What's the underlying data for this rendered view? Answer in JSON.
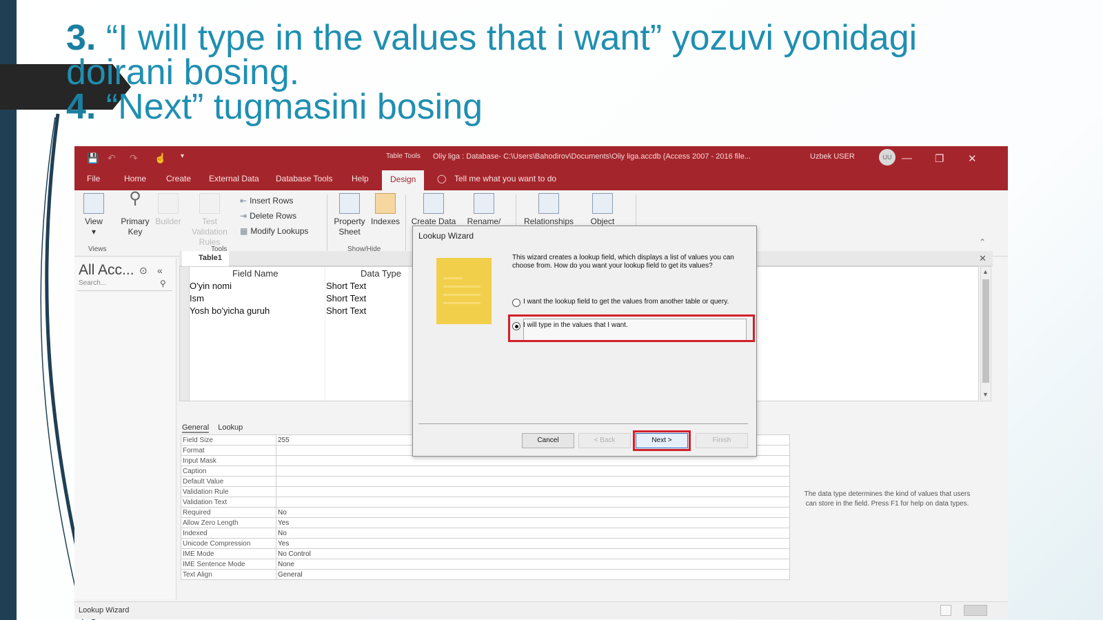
{
  "slide": {
    "line1_num": "3.",
    "line1_text": " “I will type in the values that i want” yozuvi yonidagi",
    "line2_text": "doirani bosing.",
    "line3_num": "4.",
    "line3_text": "  “Next” tugmasini bosing"
  },
  "window": {
    "context_tab": "Table Tools",
    "title": "Oliy liga : Database- C:\\Users\\Bahodirov\\Documents\\Oliy liga.accdb (Access 2007 - 2016 file...",
    "user": "Uzbek USER",
    "avatar_initials": "UU"
  },
  "menu": [
    "File",
    "Home",
    "Create",
    "External Data",
    "Database Tools",
    "Help",
    "Design"
  ],
  "tell_me": "Tell me what you want to do",
  "ribbon": {
    "view": "View",
    "primary_key_1": "Primary",
    "primary_key_2": "Key",
    "builder": "Builder",
    "test_validation": "Test Validation Rules",
    "insert_rows": "Insert Rows",
    "delete_rows": "Delete Rows",
    "modify_lookups": "Modify Lookups",
    "property_sheet_1": "Property",
    "property_sheet_2": "Sheet",
    "indexes": "Indexes",
    "create_data": "Create Data",
    "rename": "Rename/",
    "relationships": "Relationships",
    "object": "Object",
    "group_views": "Views",
    "group_tools": "Tools",
    "group_showhide": "Show/Hide"
  },
  "nav": {
    "title": "All Acc...",
    "search_placeholder": "Search..."
  },
  "table": {
    "tab": "Table1",
    "col_field": "Field Name",
    "col_type": "Data Type",
    "rows": [
      {
        "name": "O'yin nomi",
        "type": "Short Text"
      },
      {
        "name": "Ism",
        "type": "Short Text"
      },
      {
        "name": "Yosh bo'yicha guruh",
        "type": "Short Text"
      }
    ]
  },
  "props": {
    "tab_general": "General",
    "tab_lookup": "Lookup",
    "rows": [
      {
        "k": "Field Size",
        "v": "255"
      },
      {
        "k": "Format",
        "v": ""
      },
      {
        "k": "Input Mask",
        "v": ""
      },
      {
        "k": "Caption",
        "v": ""
      },
      {
        "k": "Default Value",
        "v": ""
      },
      {
        "k": "Validation Rule",
        "v": ""
      },
      {
        "k": "Validation Text",
        "v": ""
      },
      {
        "k": "Required",
        "v": "No"
      },
      {
        "k": "Allow Zero Length",
        "v": "Yes"
      },
      {
        "k": "Indexed",
        "v": "No"
      },
      {
        "k": "Unicode Compression",
        "v": "Yes"
      },
      {
        "k": "IME Mode",
        "v": "No Control"
      },
      {
        "k": "IME Sentence Mode",
        "v": "None"
      },
      {
        "k": "Text Align",
        "v": "General"
      }
    ],
    "help": "The data type determines the kind of values that users can store in the field. Press F1 for help on data types."
  },
  "wizard": {
    "title": "Lookup Wizard",
    "description": "This wizard creates a lookup field, which displays a list of values you can choose from.  How do you want your lookup field to get its values?",
    "option1": "I want the lookup field to get the values from another table or query.",
    "option2": "I will type in the values that I want.",
    "cancel": "Cancel",
    "back": "< Back",
    "next": "Next >",
    "finish": "Finish"
  },
  "status": "Lookup Wizard"
}
